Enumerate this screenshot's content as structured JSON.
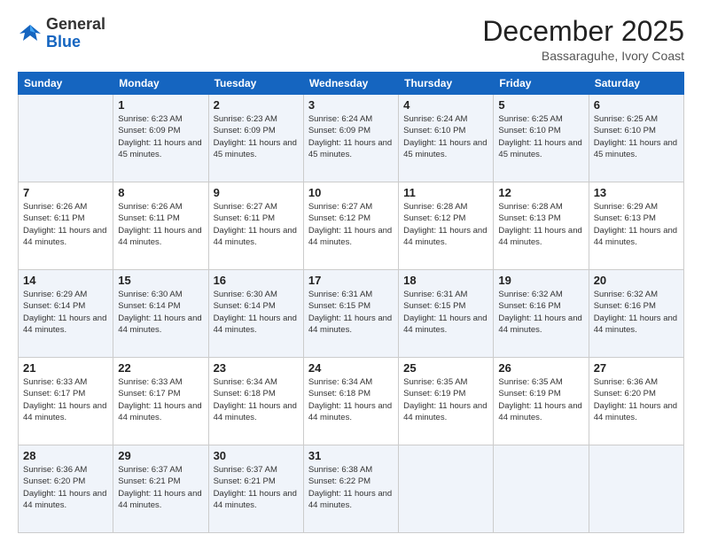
{
  "logo": {
    "general": "General",
    "blue": "Blue"
  },
  "header": {
    "month": "December 2025",
    "location": "Bassaraguhe, Ivory Coast"
  },
  "weekdays": [
    "Sunday",
    "Monday",
    "Tuesday",
    "Wednesday",
    "Thursday",
    "Friday",
    "Saturday"
  ],
  "weeks": [
    [
      {
        "day": "",
        "info": ""
      },
      {
        "day": "1",
        "info": "Sunrise: 6:23 AM\nSunset: 6:09 PM\nDaylight: 11 hours and 45 minutes."
      },
      {
        "day": "2",
        "info": "Sunrise: 6:23 AM\nSunset: 6:09 PM\nDaylight: 11 hours and 45 minutes."
      },
      {
        "day": "3",
        "info": "Sunrise: 6:24 AM\nSunset: 6:09 PM\nDaylight: 11 hours and 45 minutes."
      },
      {
        "day": "4",
        "info": "Sunrise: 6:24 AM\nSunset: 6:10 PM\nDaylight: 11 hours and 45 minutes."
      },
      {
        "day": "5",
        "info": "Sunrise: 6:25 AM\nSunset: 6:10 PM\nDaylight: 11 hours and 45 minutes."
      },
      {
        "day": "6",
        "info": "Sunrise: 6:25 AM\nSunset: 6:10 PM\nDaylight: 11 hours and 45 minutes."
      }
    ],
    [
      {
        "day": "7",
        "info": "Sunrise: 6:26 AM\nSunset: 6:11 PM\nDaylight: 11 hours and 44 minutes."
      },
      {
        "day": "8",
        "info": "Sunrise: 6:26 AM\nSunset: 6:11 PM\nDaylight: 11 hours and 44 minutes."
      },
      {
        "day": "9",
        "info": "Sunrise: 6:27 AM\nSunset: 6:11 PM\nDaylight: 11 hours and 44 minutes."
      },
      {
        "day": "10",
        "info": "Sunrise: 6:27 AM\nSunset: 6:12 PM\nDaylight: 11 hours and 44 minutes."
      },
      {
        "day": "11",
        "info": "Sunrise: 6:28 AM\nSunset: 6:12 PM\nDaylight: 11 hours and 44 minutes."
      },
      {
        "day": "12",
        "info": "Sunrise: 6:28 AM\nSunset: 6:13 PM\nDaylight: 11 hours and 44 minutes."
      },
      {
        "day": "13",
        "info": "Sunrise: 6:29 AM\nSunset: 6:13 PM\nDaylight: 11 hours and 44 minutes."
      }
    ],
    [
      {
        "day": "14",
        "info": "Sunrise: 6:29 AM\nSunset: 6:14 PM\nDaylight: 11 hours and 44 minutes."
      },
      {
        "day": "15",
        "info": "Sunrise: 6:30 AM\nSunset: 6:14 PM\nDaylight: 11 hours and 44 minutes."
      },
      {
        "day": "16",
        "info": "Sunrise: 6:30 AM\nSunset: 6:14 PM\nDaylight: 11 hours and 44 minutes."
      },
      {
        "day": "17",
        "info": "Sunrise: 6:31 AM\nSunset: 6:15 PM\nDaylight: 11 hours and 44 minutes."
      },
      {
        "day": "18",
        "info": "Sunrise: 6:31 AM\nSunset: 6:15 PM\nDaylight: 11 hours and 44 minutes."
      },
      {
        "day": "19",
        "info": "Sunrise: 6:32 AM\nSunset: 6:16 PM\nDaylight: 11 hours and 44 minutes."
      },
      {
        "day": "20",
        "info": "Sunrise: 6:32 AM\nSunset: 6:16 PM\nDaylight: 11 hours and 44 minutes."
      }
    ],
    [
      {
        "day": "21",
        "info": "Sunrise: 6:33 AM\nSunset: 6:17 PM\nDaylight: 11 hours and 44 minutes."
      },
      {
        "day": "22",
        "info": "Sunrise: 6:33 AM\nSunset: 6:17 PM\nDaylight: 11 hours and 44 minutes."
      },
      {
        "day": "23",
        "info": "Sunrise: 6:34 AM\nSunset: 6:18 PM\nDaylight: 11 hours and 44 minutes."
      },
      {
        "day": "24",
        "info": "Sunrise: 6:34 AM\nSunset: 6:18 PM\nDaylight: 11 hours and 44 minutes."
      },
      {
        "day": "25",
        "info": "Sunrise: 6:35 AM\nSunset: 6:19 PM\nDaylight: 11 hours and 44 minutes."
      },
      {
        "day": "26",
        "info": "Sunrise: 6:35 AM\nSunset: 6:19 PM\nDaylight: 11 hours and 44 minutes."
      },
      {
        "day": "27",
        "info": "Sunrise: 6:36 AM\nSunset: 6:20 PM\nDaylight: 11 hours and 44 minutes."
      }
    ],
    [
      {
        "day": "28",
        "info": "Sunrise: 6:36 AM\nSunset: 6:20 PM\nDaylight: 11 hours and 44 minutes."
      },
      {
        "day": "29",
        "info": "Sunrise: 6:37 AM\nSunset: 6:21 PM\nDaylight: 11 hours and 44 minutes."
      },
      {
        "day": "30",
        "info": "Sunrise: 6:37 AM\nSunset: 6:21 PM\nDaylight: 11 hours and 44 minutes."
      },
      {
        "day": "31",
        "info": "Sunrise: 6:38 AM\nSunset: 6:22 PM\nDaylight: 11 hours and 44 minutes."
      },
      {
        "day": "",
        "info": ""
      },
      {
        "day": "",
        "info": ""
      },
      {
        "day": "",
        "info": ""
      }
    ]
  ]
}
